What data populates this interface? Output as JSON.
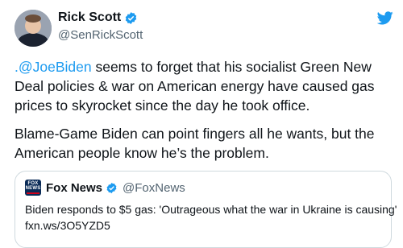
{
  "author": {
    "display_name": "Rick Scott",
    "handle": "@SenRickScott",
    "verified": true
  },
  "tweet": {
    "mention": ".@JoeBiden",
    "line1_rest": " seems to forget that his socialist Green New",
    "line2": "Deal policies & war on American energy have caused gas",
    "line3": "prices to skyrocket since the day he took office.",
    "line4": "Blame-Game Biden can point fingers all he wants, but the",
    "line5": "American people know he’s the problem."
  },
  "quoted": {
    "logo_text_top": "FOX",
    "logo_text_bottom": "NEWS",
    "display_name": "Fox News",
    "handle": "@FoxNews",
    "text": "Biden responds to $5 gas: 'Outrageous what the war in Ukraine is causing'",
    "link": "fxn.ws/3O5YZD5"
  },
  "icons": {
    "verified": "verified-badge-icon",
    "brand": "twitter-bird-icon"
  },
  "colors": {
    "accent": "#1d9bf0",
    "secondary_text": "#536471",
    "border": "#cfd9de"
  }
}
